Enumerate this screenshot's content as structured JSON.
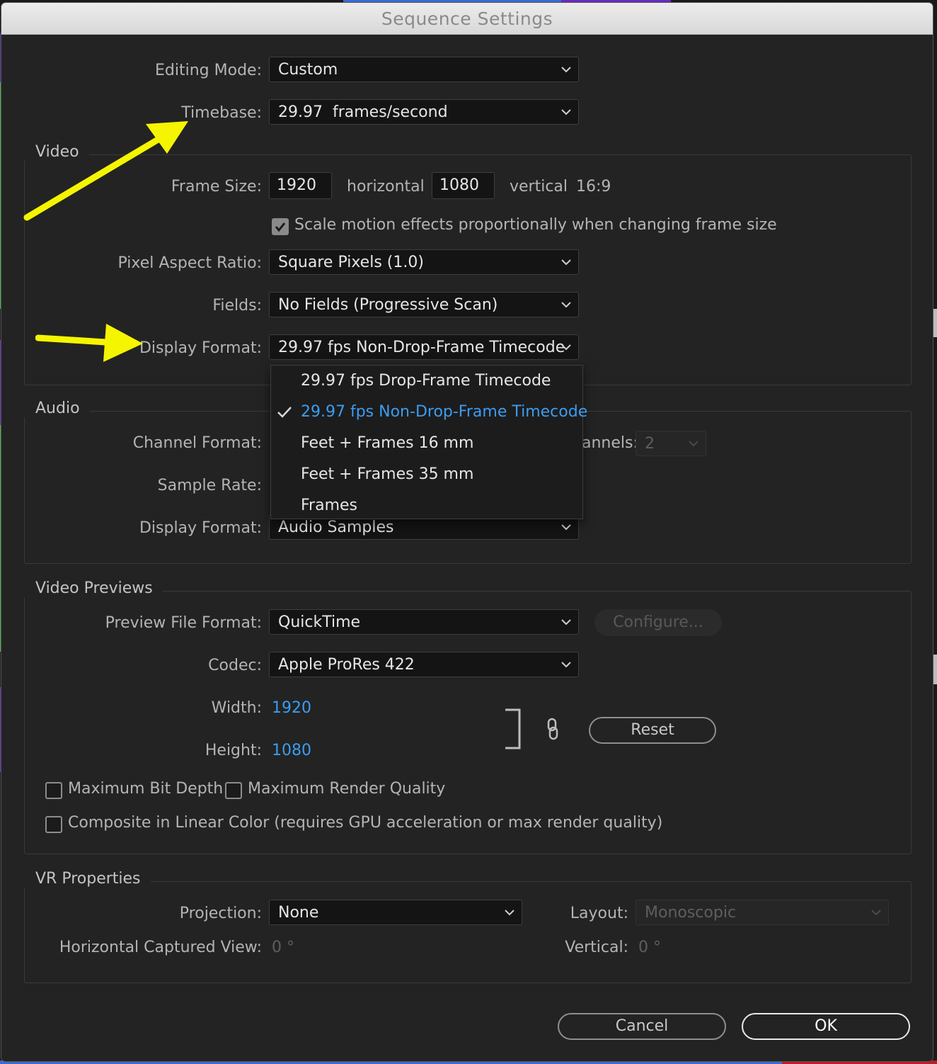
{
  "window": {
    "title": "Sequence Settings"
  },
  "general": {
    "editing_mode": {
      "label": "Editing Mode:",
      "value": "Custom"
    },
    "timebase": {
      "label": "Timebase:",
      "value": "29.97  frames/second"
    }
  },
  "video": {
    "title": "Video",
    "frame_size": {
      "label": "Frame Size:",
      "width": "1920",
      "horizontal_label": "horizontal",
      "height": "1080",
      "vertical_label": "vertical",
      "aspect": "16:9"
    },
    "scale_motion": {
      "label": "Scale motion effects proportionally when changing frame size",
      "checked": true
    },
    "pixel_aspect_ratio": {
      "label": "Pixel Aspect Ratio:",
      "value": "Square Pixels (1.0)"
    },
    "fields": {
      "label": "Fields:",
      "value": "No Fields (Progressive Scan)"
    },
    "display_format": {
      "label": "Display Format:",
      "value": "29.97 fps Non-Drop-Frame Timecode"
    }
  },
  "display_format_menu": {
    "items": [
      {
        "label": "29.97 fps Drop-Frame Timecode",
        "selected": false
      },
      {
        "label": "29.97 fps Non-Drop-Frame Timecode",
        "selected": true
      },
      {
        "label": "Feet + Frames 16 mm",
        "selected": false
      },
      {
        "label": "Feet + Frames 35 mm",
        "selected": false
      },
      {
        "label": "Frames",
        "selected": false
      }
    ]
  },
  "audio": {
    "title": "Audio",
    "channel_format": {
      "label": "Channel Format:"
    },
    "channels": {
      "label_partial": "annels:",
      "value": "2"
    },
    "sample_rate": {
      "label": "Sample Rate:"
    },
    "display_format": {
      "label": "Display Format:",
      "value": "Audio Samples"
    }
  },
  "video_previews": {
    "title": "Video Previews",
    "preview_file_format": {
      "label": "Preview File Format:",
      "value": "QuickTime"
    },
    "configure_button": "Configure...",
    "codec": {
      "label": "Codec:",
      "value": "Apple ProRes 422"
    },
    "width": {
      "label": "Width:",
      "value": "1920"
    },
    "height": {
      "label": "Height:",
      "value": "1080"
    },
    "reset_button": "Reset",
    "max_bit_depth": {
      "label": "Maximum Bit Depth",
      "checked": false
    },
    "max_render_quality": {
      "label": "Maximum Render Quality",
      "checked": false
    },
    "composite_linear": {
      "label": "Composite in Linear Color (requires GPU acceleration or max render quality)",
      "checked": false
    }
  },
  "vr": {
    "title": "VR Properties",
    "projection": {
      "label": "Projection:",
      "value": "None"
    },
    "layout": {
      "label": "Layout:",
      "value": "Monoscopic"
    },
    "horizontal_view": {
      "label": "Horizontal Captured View:",
      "value": "0 °"
    },
    "vertical": {
      "label": "Vertical:",
      "value": "0 °"
    }
  },
  "footer": {
    "cancel": "Cancel",
    "ok": "OK"
  },
  "colors": {
    "accent_blue": "#3c9cf0",
    "annotation_arrow": "#f5f500",
    "dialog_bg": "#232323"
  }
}
